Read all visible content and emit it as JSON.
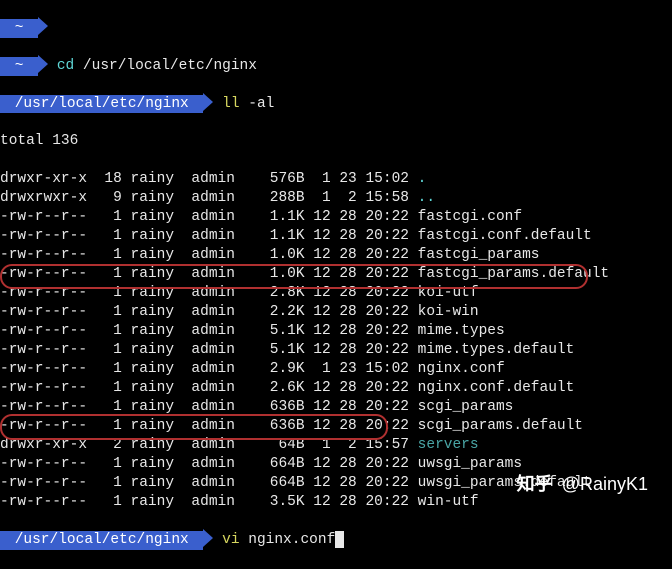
{
  "prompt1": {
    "path": "~",
    "cmd": "",
    "cmd_color": ""
  },
  "prompt2": {
    "path": "~",
    "cmd": "cd",
    "arg": "/usr/local/etc/nginx"
  },
  "prompt3": {
    "path": "/usr/local/etc/nginx",
    "cmd": "ll",
    "arg": "-al"
  },
  "total": "total 136",
  "rows": [
    {
      "perm": "drwxr-xr-x",
      "links": "18",
      "user": "rainy",
      "group": "admin",
      "size": "576B",
      "date": " 1 23 15:02",
      "name": ".",
      "cls": "cyan"
    },
    {
      "perm": "drwxrwxr-x",
      "links": " 9",
      "user": "rainy",
      "group": "admin",
      "size": "288B",
      "date": " 1  2 15:58",
      "name": "..",
      "cls": "cyan"
    },
    {
      "perm": "-rw-r--r--",
      "links": " 1",
      "user": "rainy",
      "group": "admin",
      "size": "1.1K",
      "date": "12 28 20:22",
      "name": "fastcgi.conf",
      "cls": "white"
    },
    {
      "perm": "-rw-r--r--",
      "links": " 1",
      "user": "rainy",
      "group": "admin",
      "size": "1.1K",
      "date": "12 28 20:22",
      "name": "fastcgi.conf.default",
      "cls": "white"
    },
    {
      "perm": "-rw-r--r--",
      "links": " 1",
      "user": "rainy",
      "group": "admin",
      "size": "1.0K",
      "date": "12 28 20:22",
      "name": "fastcgi_params",
      "cls": "white"
    },
    {
      "perm": "-rw-r--r--",
      "links": " 1",
      "user": "rainy",
      "group": "admin",
      "size": "1.0K",
      "date": "12 28 20:22",
      "name": "fastcgi_params.default",
      "cls": "white"
    },
    {
      "perm": "-rw-r--r--",
      "links": " 1",
      "user": "rainy",
      "group": "admin",
      "size": "2.8K",
      "date": "12 28 20:22",
      "name": "koi-utf",
      "cls": "white"
    },
    {
      "perm": "-rw-r--r--",
      "links": " 1",
      "user": "rainy",
      "group": "admin",
      "size": "2.2K",
      "date": "12 28 20:22",
      "name": "koi-win",
      "cls": "white"
    },
    {
      "perm": "-rw-r--r--",
      "links": " 1",
      "user": "rainy",
      "group": "admin",
      "size": "5.1K",
      "date": "12 28 20:22",
      "name": "mime.types",
      "cls": "white"
    },
    {
      "perm": "-rw-r--r--",
      "links": " 1",
      "user": "rainy",
      "group": "admin",
      "size": "5.1K",
      "date": "12 28 20:22",
      "name": "mime.types.default",
      "cls": "white"
    },
    {
      "perm": "-rw-r--r--",
      "links": " 1",
      "user": "rainy",
      "group": "admin",
      "size": "2.9K",
      "date": " 1 23 15:02",
      "name": "nginx.conf",
      "cls": "white"
    },
    {
      "perm": "-rw-r--r--",
      "links": " 1",
      "user": "rainy",
      "group": "admin",
      "size": "2.6K",
      "date": "12 28 20:22",
      "name": "nginx.conf.default",
      "cls": "white"
    },
    {
      "perm": "-rw-r--r--",
      "links": " 1",
      "user": "rainy",
      "group": "admin",
      "size": "636B",
      "date": "12 28 20:22",
      "name": "scgi_params",
      "cls": "white"
    },
    {
      "perm": "-rw-r--r--",
      "links": " 1",
      "user": "rainy",
      "group": "admin",
      "size": "636B",
      "date": "12 28 20:22",
      "name": "scgi_params.default",
      "cls": "white"
    },
    {
      "perm": "drwxr-xr-x",
      "links": " 2",
      "user": "rainy",
      "group": "admin",
      "size": " 64B",
      "date": " 1  2 15:57",
      "name": "servers",
      "cls": "teal"
    },
    {
      "perm": "-rw-r--r--",
      "links": " 1",
      "user": "rainy",
      "group": "admin",
      "size": "664B",
      "date": "12 28 20:22",
      "name": "uwsgi_params",
      "cls": "white"
    },
    {
      "perm": "-rw-r--r--",
      "links": " 1",
      "user": "rainy",
      "group": "admin",
      "size": "664B",
      "date": "12 28 20:22",
      "name": "uwsgi_params.default",
      "cls": "white"
    },
    {
      "perm": "-rw-r--r--",
      "links": " 1",
      "user": "rainy",
      "group": "admin",
      "size": "3.5K",
      "date": "12 28 20:22",
      "name": "win-utf",
      "cls": "white"
    }
  ],
  "prompt4": {
    "path": "/usr/local/etc/nginx",
    "cmd": "vi",
    "arg": "nginx.conf"
  },
  "watermark": {
    "brand": "知乎",
    "handle": "@RainyK1"
  }
}
